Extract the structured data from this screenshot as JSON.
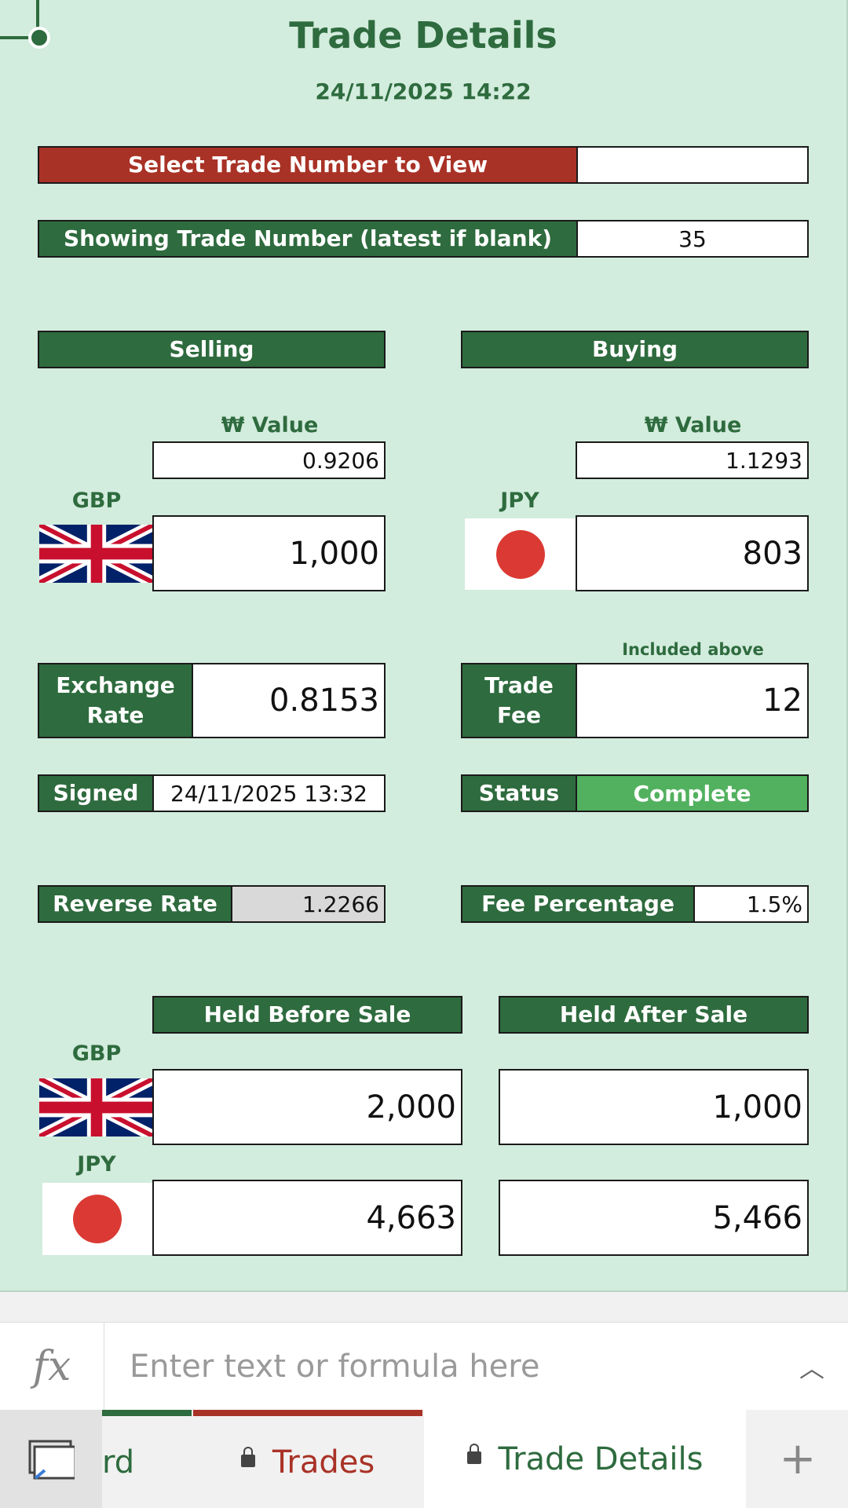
{
  "title": "Trade Details",
  "timestamp": "24/11/2025 14:22",
  "select_trade": {
    "label": "Select Trade Number to View",
    "value": ""
  },
  "showing_trade": {
    "label": "Showing Trade Number (latest if blank)",
    "value": "35"
  },
  "selling": {
    "header": "Selling",
    "value_label": "₩ Value",
    "unit_value": "0.9206",
    "currency": "GBP",
    "amount": "1,000"
  },
  "buying": {
    "header": "Buying",
    "value_label": "₩ Value",
    "unit_value": "1.1293",
    "currency": "JPY",
    "amount": "803"
  },
  "exchange_rate": {
    "label_line1": "Exchange",
    "label_line2": "Rate",
    "value": "0.8153"
  },
  "trade_fee": {
    "note": "Included above",
    "label_line1": "Trade",
    "label_line2": "Fee",
    "value": "12"
  },
  "signed": {
    "label": "Signed",
    "value": "24/11/2025 13:32"
  },
  "status": {
    "label": "Status",
    "value": "Complete",
    "color": "#52b15f"
  },
  "reverse_rate": {
    "label": "Reverse Rate",
    "value": "1.2266"
  },
  "fee_percentage": {
    "label": "Fee Percentage",
    "value": "1.5%"
  },
  "holdings": {
    "before_header": "Held Before Sale",
    "after_header": "Held After Sale",
    "rows": [
      {
        "currency": "GBP",
        "before": "2,000",
        "after": "1,000"
      },
      {
        "currency": "JPY",
        "before": "4,663",
        "after": "5,466"
      }
    ]
  },
  "formula_bar": {
    "placeholder": "Enter text or formula here"
  },
  "tabs": [
    {
      "label": "rd",
      "accent": "#2e6b3e"
    },
    {
      "label": "Trades",
      "accent": "#a93226"
    },
    {
      "label": "Trade Details",
      "accent": "#2e6b3e",
      "active": true
    },
    {
      "label": "+"
    }
  ],
  "colors": {
    "sheet_bg": "#d2ecdd",
    "green": "#2e6b3e",
    "red": "#a93226"
  }
}
